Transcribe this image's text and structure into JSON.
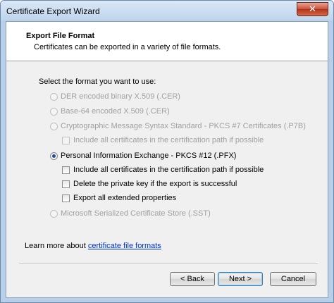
{
  "window": {
    "title": "Certificate Export Wizard",
    "close_glyph": "✕"
  },
  "header": {
    "title": "Export File Format",
    "subtitle": "Certificates can be exported in a variety of file formats."
  },
  "prompt": "Select the format you want to use:",
  "options": {
    "der": "DER encoded binary X.509 (.CER)",
    "base64": "Base-64 encoded X.509 (.CER)",
    "p7b": "Cryptographic Message Syntax Standard - PKCS #7 Certificates (.P7B)",
    "p7b_include": "Include all certificates in the certification path if possible",
    "pfx": "Personal Information Exchange - PKCS #12 (.PFX)",
    "pfx_include": "Include all certificates in the certification path if possible",
    "pfx_delete": "Delete the private key if the export is successful",
    "pfx_export_props": "Export all extended properties",
    "sst": "Microsoft Serialized Certificate Store (.SST)"
  },
  "learn": {
    "prefix": "Learn more about ",
    "link": "certificate file formats"
  },
  "buttons": {
    "back": "< Back",
    "next": "Next >",
    "cancel": "Cancel"
  },
  "colors": {
    "link": "#0033cc",
    "selected_radio": "#1b4f9e"
  }
}
